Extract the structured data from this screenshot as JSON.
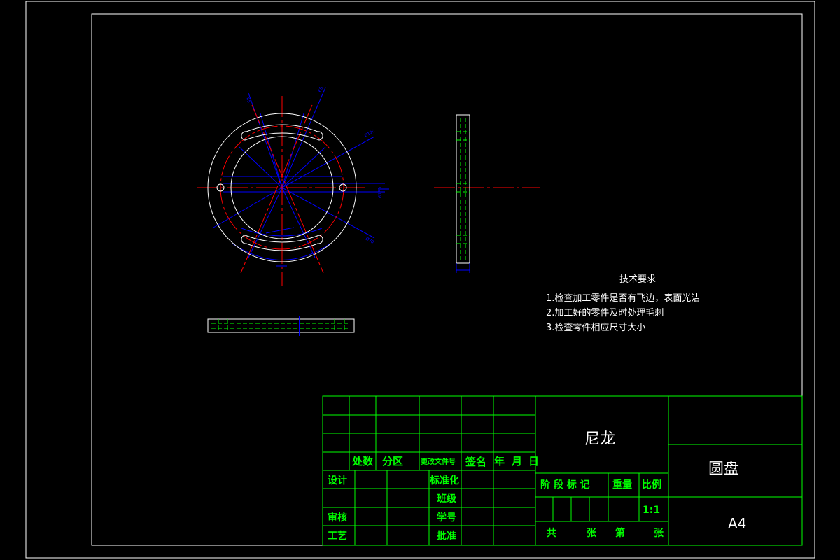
{
  "tech_req": {
    "title": "技术要求",
    "lines": [
      "1.检查加工零件是否有飞边，表面光洁",
      "2.加工好的零件及时处理毛刺",
      "3.检查零件相应尺寸大小"
    ]
  },
  "title_block": {
    "material": "尼龙",
    "part_name": "圆盘",
    "sheet_size": "A4",
    "scale_value": "1:1",
    "rev_headers": [
      "处数",
      "分区",
      "更改文件号",
      "签名",
      "年",
      "月",
      "日"
    ],
    "sign_labels": {
      "design": "设计",
      "standard": "标准化",
      "class": "班级",
      "review": "审核",
      "student_id": "学号",
      "process": "工艺",
      "approve": "批准"
    },
    "stage_labels": {
      "stage": "阶 段 标 记",
      "weight": "重量",
      "scale": "比例"
    },
    "sheet_labels": {
      "total": "共",
      "sheets": "张",
      "no": "第",
      "sheet": "张"
    }
  },
  "colors": {
    "background": "#000000",
    "outline": "#ffffff",
    "hidden_line": "#00ff00",
    "center_line": "#ff0000",
    "dimension": "#0000ff",
    "title_text": "#00ff00",
    "text": "#ffffff"
  }
}
